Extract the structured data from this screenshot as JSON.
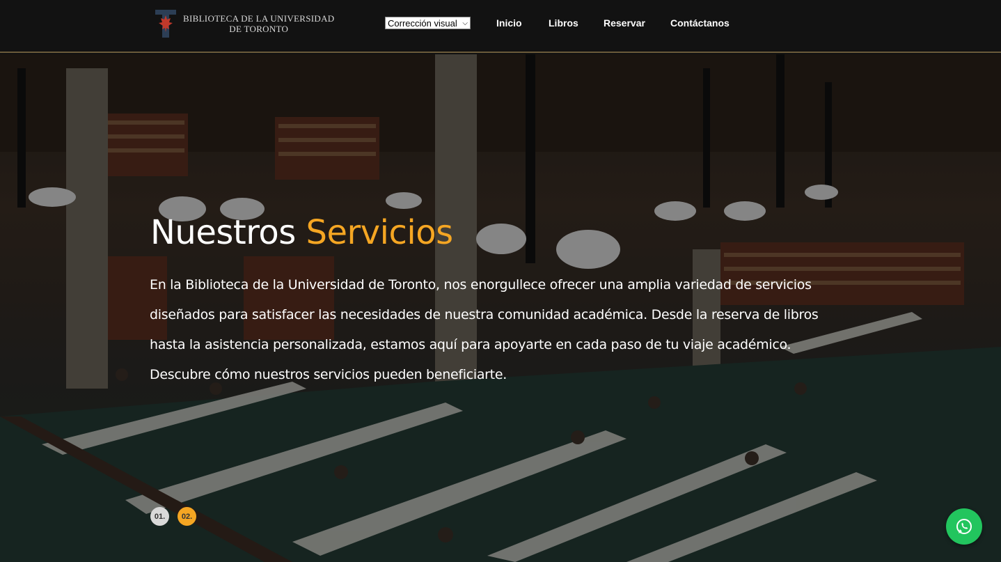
{
  "header": {
    "logo_line1": "BIBLIOTECA DE LA UNIVERSIDAD",
    "logo_line2": "DE TORONTO",
    "logo_icon": "maple-leaf-t-icon",
    "select_value": "Corrección visual",
    "nav": {
      "inicio": "Inicio",
      "libros": "Libros",
      "reservar": "Reservar",
      "contactanos": "Contáctanos"
    }
  },
  "hero": {
    "title_main": "Nuestros",
    "title_accent": "Servicios",
    "accent_color": "#f5a623",
    "paragraph": "En la Biblioteca de la Universidad de Toronto, nos enorgullece ofrecer una amplia variedad de servicios diseñados para satisfacer las necesidades de nuestra comunidad académica. Desde la reserva de libros hasta la asistencia personalizada, estamos aquí para apoyarte en cada paso de tu viaje académico. Descubre cómo nuestros servicios pueden beneficiarte."
  },
  "slider": {
    "dot1": "01.",
    "dot2": "02.",
    "active": "02."
  },
  "whatsapp": {
    "icon": "whatsapp-icon",
    "color": "#22c55e"
  }
}
